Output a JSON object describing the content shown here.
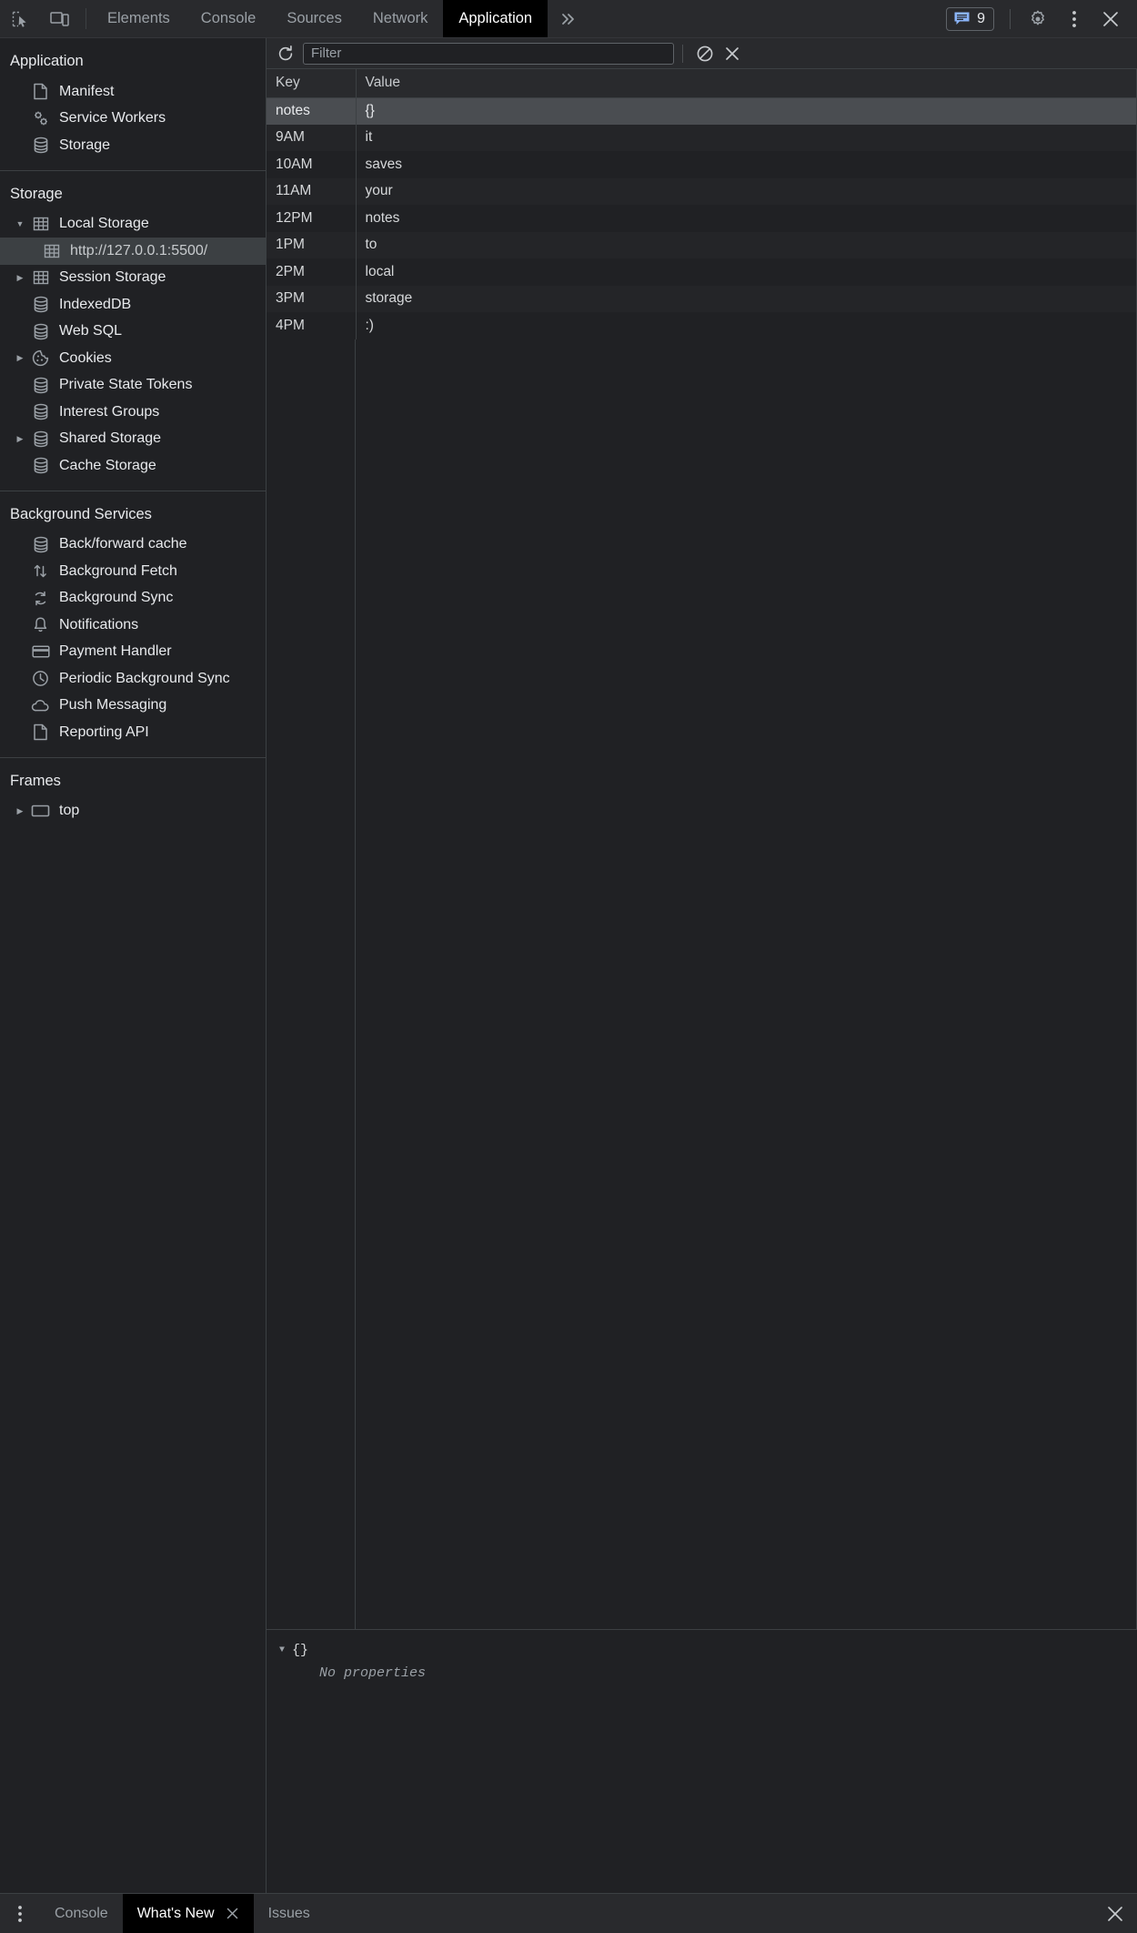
{
  "topbar": {
    "inspect_icon": "inspect-cursor-icon",
    "device_icon": "device-toolbar-icon",
    "tabs": [
      {
        "label": "Elements",
        "active": false
      },
      {
        "label": "Console",
        "active": false
      },
      {
        "label": "Sources",
        "active": false
      },
      {
        "label": "Network",
        "active": false
      },
      {
        "label": "Application",
        "active": true
      }
    ],
    "more_tabs": "»",
    "message_count": "9",
    "settings_icon": "gear-icon",
    "kebab_icon": "more-vertical-icon",
    "close_icon": "close-icon"
  },
  "sidebar": {
    "sections": [
      {
        "title": "Application",
        "items": [
          {
            "label": "Manifest",
            "icon": "document-icon",
            "arrow": "none",
            "selected": false
          },
          {
            "label": "Service Workers",
            "icon": "gears-icon",
            "arrow": "none",
            "selected": false
          },
          {
            "label": "Storage",
            "icon": "database-icon",
            "arrow": "none",
            "selected": false
          }
        ]
      },
      {
        "title": "Storage",
        "items": [
          {
            "label": "Local Storage",
            "icon": "table-icon",
            "arrow": "down",
            "selected": false
          },
          {
            "label": "http://127.0.0.1:5500/",
            "icon": "table-icon",
            "arrow": "none",
            "selected": true,
            "indent": true
          },
          {
            "label": "Session Storage",
            "icon": "table-icon",
            "arrow": "right",
            "selected": false
          },
          {
            "label": "IndexedDB",
            "icon": "database-icon",
            "arrow": "none",
            "selected": false
          },
          {
            "label": "Web SQL",
            "icon": "database-icon",
            "arrow": "none",
            "selected": false
          },
          {
            "label": "Cookies",
            "icon": "cookie-icon",
            "arrow": "right",
            "selected": false
          },
          {
            "label": "Private State Tokens",
            "icon": "database-icon",
            "arrow": "none",
            "selected": false
          },
          {
            "label": "Interest Groups",
            "icon": "database-icon",
            "arrow": "none",
            "selected": false
          },
          {
            "label": "Shared Storage",
            "icon": "database-icon",
            "arrow": "right",
            "selected": false
          },
          {
            "label": "Cache Storage",
            "icon": "database-icon",
            "arrow": "none",
            "selected": false
          }
        ]
      },
      {
        "title": "Background Services",
        "items": [
          {
            "label": "Back/forward cache",
            "icon": "database-icon",
            "arrow": "none",
            "selected": false
          },
          {
            "label": "Background Fetch",
            "icon": "arrows-updown-icon",
            "arrow": "none",
            "selected": false
          },
          {
            "label": "Background Sync",
            "icon": "sync-icon",
            "arrow": "none",
            "selected": false
          },
          {
            "label": "Notifications",
            "icon": "bell-icon",
            "arrow": "none",
            "selected": false
          },
          {
            "label": "Payment Handler",
            "icon": "credit-card-icon",
            "arrow": "none",
            "selected": false
          },
          {
            "label": "Periodic Background Sync",
            "icon": "clock-icon",
            "arrow": "none",
            "selected": false
          },
          {
            "label": "Push Messaging",
            "icon": "cloud-icon",
            "arrow": "none",
            "selected": false
          },
          {
            "label": "Reporting API",
            "icon": "document-icon",
            "arrow": "none",
            "selected": false
          }
        ]
      },
      {
        "title": "Frames",
        "items": [
          {
            "label": "top",
            "icon": "frame-icon",
            "arrow": "right",
            "selected": false
          }
        ]
      }
    ]
  },
  "panel": {
    "refresh_icon": "refresh-icon",
    "filter_placeholder": "Filter",
    "clear_icon": "clear-filter-icon",
    "delete_icon": "delete-icon",
    "table": {
      "columns": [
        "Key",
        "Value"
      ],
      "rows": [
        {
          "key": "notes",
          "value": "{}",
          "selected": true
        },
        {
          "key": "9AM",
          "value": "it",
          "selected": false
        },
        {
          "key": "10AM",
          "value": "saves",
          "selected": false
        },
        {
          "key": "11AM",
          "value": "your",
          "selected": false
        },
        {
          "key": "12PM",
          "value": "notes",
          "selected": false
        },
        {
          "key": "1PM",
          "value": "to",
          "selected": false
        },
        {
          "key": "2PM",
          "value": "local",
          "selected": false
        },
        {
          "key": "3PM",
          "value": "storage",
          "selected": false
        },
        {
          "key": "4PM",
          "value": ":)",
          "selected": false
        }
      ]
    },
    "preview": {
      "root": "{}",
      "empty_message": "No properties"
    }
  },
  "drawer": {
    "kebab_icon": "more-vertical-icon",
    "tabs": [
      {
        "label": "Console",
        "active": false,
        "closable": false
      },
      {
        "label": "What's New",
        "active": true,
        "closable": true
      },
      {
        "label": "Issues",
        "active": false,
        "closable": false
      }
    ],
    "close_icon": "close-icon"
  },
  "colors": {
    "accent": "#8ab4f8",
    "panel_bg": "#202124",
    "toolbar_bg": "#292a2d",
    "border": "#3c4043",
    "selected_row": "#4a4d51",
    "text": "#e8eaed",
    "muted": "#9aa0a6"
  }
}
